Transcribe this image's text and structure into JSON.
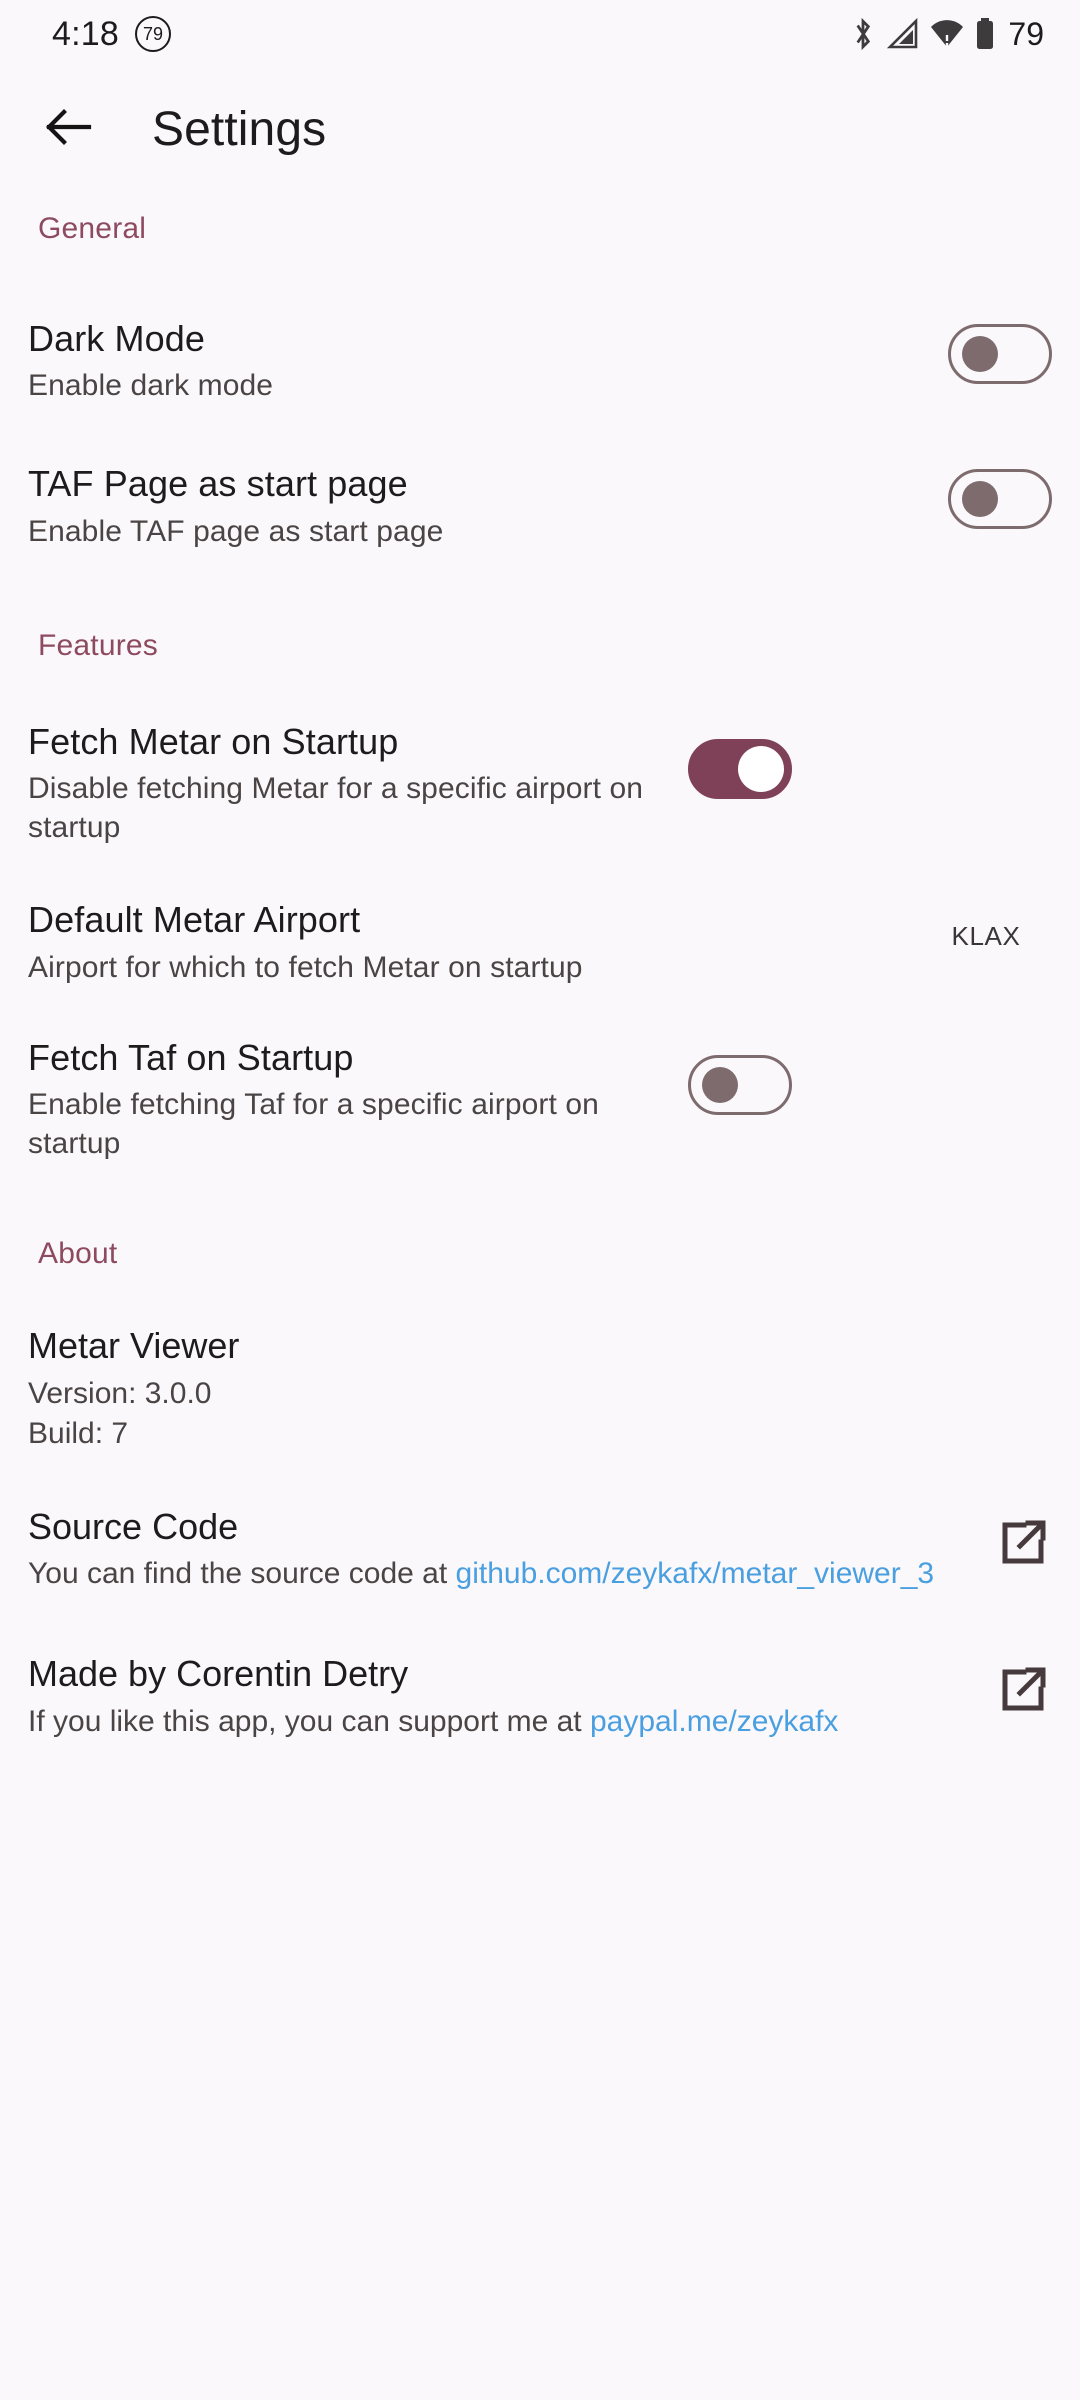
{
  "status_bar": {
    "time": "4:18",
    "badge": "79",
    "icons": [
      "bluetooth-icon",
      "cellular-signal-icon",
      "wifi-icon",
      "battery-icon"
    ],
    "battery_level": "79"
  },
  "app_bar": {
    "back_label": "back-arrow-icon",
    "title": "Settings"
  },
  "colors": {
    "accent": "#8e4a5f",
    "switch_on_track": "#7e4157",
    "switch_off": "#7d6b6e",
    "link": "#4a9fe0",
    "background": "#faf8fa"
  },
  "sections": [
    {
      "header": "General",
      "items": [
        {
          "title": "Dark Mode",
          "subtitle": "Enable dark mode",
          "control": "switch",
          "state": "off"
        },
        {
          "title": "TAF Page as start page",
          "subtitle": "Enable TAF page as start page",
          "control": "switch",
          "state": "off"
        }
      ]
    },
    {
      "header": "Features",
      "items": [
        {
          "title": "Fetch Metar on Startup",
          "subtitle": "Disable fetching Metar for a specific airport on startup",
          "control": "switch",
          "state": "on"
        },
        {
          "title": "Default Metar Airport",
          "subtitle": "Airport for which to fetch Metar on startup",
          "control": "value",
          "value": "KLAX"
        },
        {
          "title": "Fetch Taf on Startup",
          "subtitle": "Enable fetching Taf for a specific airport on startup",
          "control": "switch",
          "state": "off"
        }
      ]
    },
    {
      "header": "About",
      "app_info": {
        "title": "Metar Viewer",
        "version_line": "Version: 3.0.0",
        "build_line": "Build: 7"
      },
      "links": [
        {
          "title": "Source Code",
          "prefix": "You can find the source code at ",
          "link_text": "github.com/zeykafx/metar_viewer_3",
          "icon": "open-in-new-icon"
        },
        {
          "title": "Made by Corentin Detry",
          "prefix": "If you like this app, you can support me at ",
          "link_text": "paypal.me/zeykafx",
          "icon": "open-in-new-icon"
        }
      ]
    }
  ]
}
